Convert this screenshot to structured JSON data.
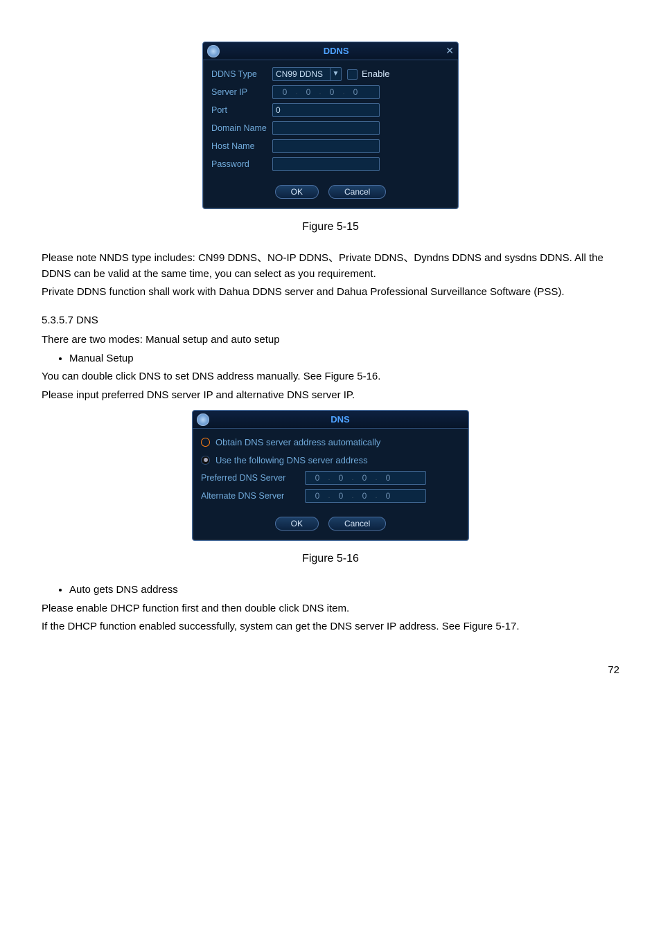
{
  "ddns": {
    "title": "DDNS",
    "labels": {
      "type": "DDNS Type",
      "serverip": "Server IP",
      "port": "Port",
      "domain": "Domain Name",
      "host": "Host Name",
      "password": "Password"
    },
    "type_value": "CN99 DDNS",
    "enable_label": "Enable",
    "server_ip": [
      "0",
      "0",
      "0",
      "0"
    ],
    "port_value": "0",
    "ok": "OK",
    "cancel": "Cancel"
  },
  "caption1": "Figure 5-15",
  "para1": "Please note NNDS type includes: CN99 DDNS、NO-IP DDNS、Private DDNS、Dyndns DDNS and sysdns DDNS. All the DDNS can be valid at the same time, you can select as you requirement.",
  "para2": "Private DDNS function shall work with Dahua DDNS server and Dahua Professional Surveillance Software (PSS).",
  "section_head": "5.3.5.7  DNS",
  "para3": "There are two modes: Manual setup and auto setup",
  "bullet1": "Manual Setup",
  "para4": "You can double click DNS to set DNS address manually. See Figure 5-16.",
  "para5": "Please input preferred DNS server IP and alternative DNS server IP.",
  "dns": {
    "title": "DNS",
    "radio_auto": "Obtain DNS server address automatically",
    "radio_manual": "Use the following DNS server address",
    "pref_label": "Preferred DNS Server",
    "alt_label": "Alternate DNS Server",
    "pref_ip": [
      "0",
      "0",
      "0",
      "0"
    ],
    "alt_ip": [
      "0",
      "0",
      "0",
      "0"
    ],
    "ok": "OK",
    "cancel": "Cancel"
  },
  "caption2": "Figure 5-16",
  "bullet2": "Auto gets DNS address",
  "para6": "Please enable DHCP function first and then double click DNS item.",
  "para7": "If the DHCP function enabled successfully, system can get the DNS server IP address. See Figure 5-17.",
  "page_no": "72"
}
